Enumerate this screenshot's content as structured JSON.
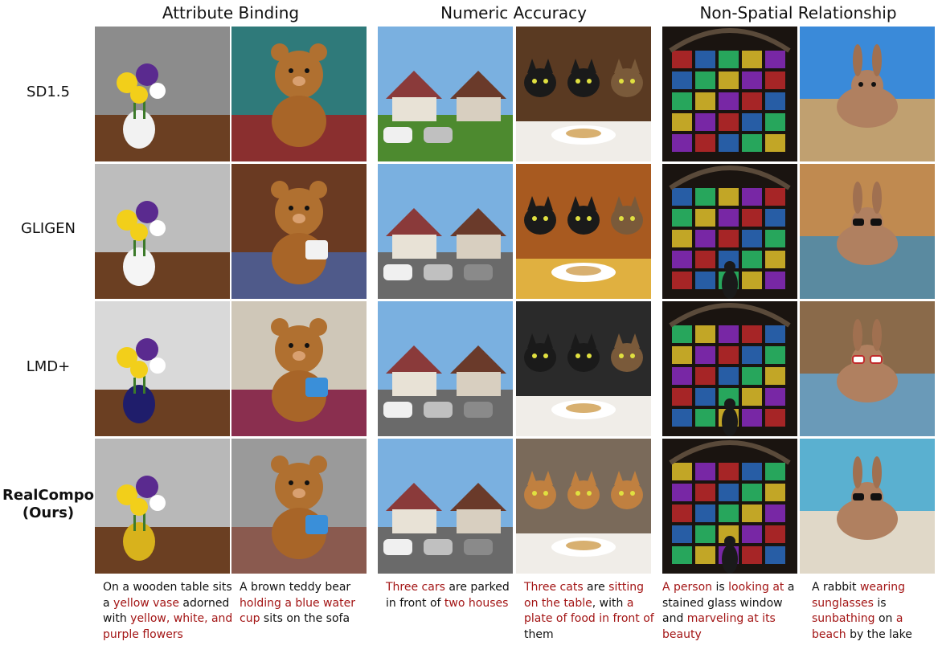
{
  "columns": [
    {
      "title": "Attribute Binding"
    },
    {
      "title": "Numeric Accuracy"
    },
    {
      "title": "Non-Spatial Relationship"
    }
  ],
  "rows": [
    {
      "label": "SD1.5"
    },
    {
      "label": "GLIGEN"
    },
    {
      "label": "LMD+"
    },
    {
      "label": "RealCompo",
      "label2": "(Ours)"
    }
  ],
  "captions": [
    [
      {
        "t": "On a wooden table sits a "
      },
      {
        "t": "yellow vase",
        "h": true
      },
      {
        "t": " adorned with "
      },
      {
        "t": "yellow, white, and purple flowers",
        "h": true
      }
    ],
    [
      {
        "t": "A brown teddy bear "
      },
      {
        "t": "holding a blue water cup",
        "h": true
      },
      {
        "t": " sits on the sofa"
      }
    ],
    [
      {
        "t": "Three cars",
        "h": true
      },
      {
        "t": " are parked in front of "
      },
      {
        "t": "two houses",
        "h": true
      }
    ],
    [
      {
        "t": "Three cats",
        "h": true
      },
      {
        "t": " are "
      },
      {
        "t": "sitting on the table",
        "h": true
      },
      {
        "t": ", with "
      },
      {
        "t": "a plate of food in front of",
        "h": true
      },
      {
        "t": " them"
      }
    ],
    [
      {
        "t": "A person",
        "h": true
      },
      {
        "t": " is "
      },
      {
        "t": "looking at",
        "h": true
      },
      {
        "t": " a stained glass window and "
      },
      {
        "t": "marveling at its beauty",
        "h": true
      }
    ],
    [
      {
        "t": "A rabbit "
      },
      {
        "t": "wearing sunglasses",
        "h": true
      },
      {
        "t": " is "
      },
      {
        "t": "sunbathing",
        "h": true
      },
      {
        "t": " on "
      },
      {
        "t": "a beach",
        "h": true
      },
      {
        "t": " by the lake"
      }
    ]
  ],
  "colors": {
    "highlight": "#a31515",
    "text": "#111111"
  }
}
